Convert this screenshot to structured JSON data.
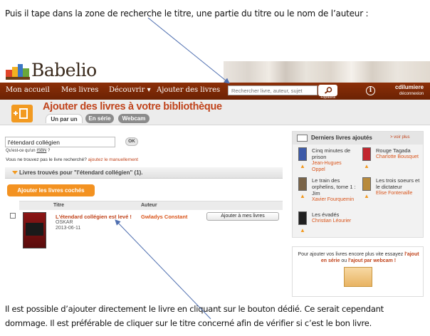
{
  "captions": {
    "top": "Puis il tape dans la zone de recherche le titre, une partie du titre  ou le nom de l’auteur :",
    "bottom": "Il est possible d’ajouter directement le livre en cliquant sur le bouton dédié. Ce serait cependant dommage. Il est préférable de cliquer sur le titre concerné afin de vérifier si c’est le bon livre."
  },
  "app": {
    "logo": "Babelio"
  },
  "nav": {
    "items": [
      {
        "label": "Mon accueil"
      },
      {
        "label": "Mes livres"
      },
      {
        "label": "Découvrir ▾"
      },
      {
        "label": "Ajouter des livres"
      }
    ],
    "search_placeholder": "Rechercher livre, auteur, sujet",
    "search_options": "+options",
    "user_name": "cdilumiere",
    "logout": "déconnexion"
  },
  "page": {
    "title": "Ajouter des livres à votre bibliothèque",
    "tabs": [
      {
        "label": "Un par un",
        "active": true
      },
      {
        "label": "En série",
        "active": false
      },
      {
        "label": "Webcam",
        "active": false
      }
    ]
  },
  "search": {
    "value": "l'étendard collégien",
    "ok": "OK",
    "isbn_prefix": "Qu'est-ce qu'un",
    "isbn_link": "ISBN",
    "isbn_suffix": "?",
    "notfound_text": "Vous ne trouvez pas le livre recherché?",
    "notfound_link": "ajoutez le manuellement"
  },
  "results": {
    "header": "Livres trouvés pour \"l'étendard collégien\" (1).",
    "add_checked": "Ajouter les livres cochés",
    "columns": {
      "title": "Titre",
      "author": "Auteur"
    },
    "rows": [
      {
        "title": "L'étendard collégien est levé !",
        "publisher": "OSKAR",
        "date": "2013-06-11",
        "author": "Gwladys Constant",
        "action": "Ajouter à mes livres"
      }
    ]
  },
  "sidebar": {
    "title": "Derniers livres ajoutés",
    "more": "> voir plus",
    "books": [
      {
        "title": "Cinq minutes de prison",
        "author": "Jean-Hugues Oppel",
        "cover_color": "#3d5aa8"
      },
      {
        "title": "Rouge Tagada",
        "author": "Charlotte Bousquet",
        "cover_color": "#c2262e"
      },
      {
        "title": "Le train des orphelins, tome 1 : Jim",
        "author": "Xavier Fourquemin",
        "cover_color": "#7a6448"
      },
      {
        "title": "Les trois soeurs et le dictateur",
        "author": "Elise Fontenaille",
        "cover_color": "#b88a3c"
      },
      {
        "title": "Les évadés",
        "author": "Christian Léourier",
        "cover_color": "#202020"
      }
    ],
    "promo_prefix": "Pour ajouter vos livres encore plus vite essayez",
    "promo_link1": "l'ajout en série",
    "promo_mid": "ou",
    "promo_link2": "l'ajout par webcam !"
  },
  "colors": {
    "brand": "#7a2706",
    "accent": "#f29a21",
    "link": "#c0431b"
  }
}
